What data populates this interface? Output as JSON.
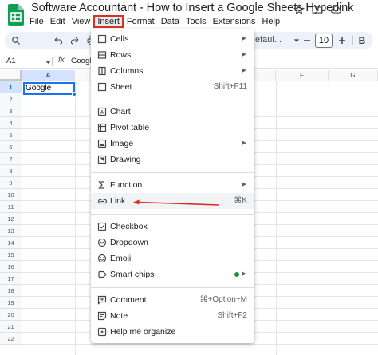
{
  "app": {
    "title": "Software Accountant - How to Insert a Google Sheets Hyperlink",
    "brand_color": "#0f9d58"
  },
  "title_icons": [
    "star-icon",
    "folder-move-icon",
    "cloud-status-icon"
  ],
  "menubar": [
    {
      "label": "File"
    },
    {
      "label": "Edit"
    },
    {
      "label": "View"
    },
    {
      "label": "Insert",
      "active": true
    },
    {
      "label": "Format"
    },
    {
      "label": "Data"
    },
    {
      "label": "Tools"
    },
    {
      "label": "Extensions"
    },
    {
      "label": "Help"
    }
  ],
  "toolbar": {
    "font_name": "efaul...",
    "font_size": "10",
    "icons": [
      "search-icon",
      "undo-icon",
      "redo-icon",
      "print-icon",
      "paint-format-icon",
      "decrease-font-size-icon",
      "increase-font-size-icon"
    ]
  },
  "formula_bar": {
    "name_box": "A1",
    "value": "Google"
  },
  "grid": {
    "columns": [
      "A",
      "F",
      "G"
    ],
    "rows": [
      "1",
      "2",
      "3",
      "4",
      "5",
      "6",
      "7",
      "8",
      "9",
      "10",
      "11",
      "12",
      "13",
      "14",
      "15",
      "16",
      "17",
      "18",
      "19",
      "20",
      "21",
      "22"
    ],
    "selected_cell": {
      "ref": "A1",
      "value": "Google"
    },
    "selection_color": "#1a73e8"
  },
  "insert_menu": {
    "items": [
      {
        "icon": "cells-icon",
        "label": "Cells",
        "submenu": true
      },
      {
        "icon": "rows-icon",
        "label": "Rows",
        "submenu": true
      },
      {
        "icon": "columns-icon",
        "label": "Columns",
        "submenu": true
      },
      {
        "icon": "sheet-icon",
        "label": "Sheet",
        "shortcut": "Shift+F11"
      },
      {
        "icon": "chart-icon",
        "label": "Chart"
      },
      {
        "icon": "pivot-table-icon",
        "label": "Pivot table"
      },
      {
        "icon": "image-icon",
        "label": "Image",
        "submenu": true
      },
      {
        "icon": "drawing-icon",
        "label": "Drawing"
      },
      {
        "icon": "function-icon",
        "label": "Function",
        "submenu": true
      },
      {
        "icon": "link-icon",
        "label": "Link",
        "shortcut": "⌘K",
        "highlighted": true
      },
      {
        "icon": "checkbox-icon",
        "label": "Checkbox"
      },
      {
        "icon": "dropdown-icon",
        "label": "Dropdown"
      },
      {
        "icon": "emoji-icon",
        "label": "Emoji"
      },
      {
        "icon": "smart-chips-icon",
        "label": "Smart chips",
        "submenu": true,
        "status_dot": "#1e8e3e"
      },
      {
        "icon": "comment-icon",
        "label": "Comment",
        "shortcut": "⌘+Option+M"
      },
      {
        "icon": "note-icon",
        "label": "Note",
        "shortcut": "Shift+F2"
      },
      {
        "icon": "help-me-organize-icon",
        "label": "Help me organize"
      }
    ]
  },
  "annotation": {
    "color": "#d93025"
  }
}
